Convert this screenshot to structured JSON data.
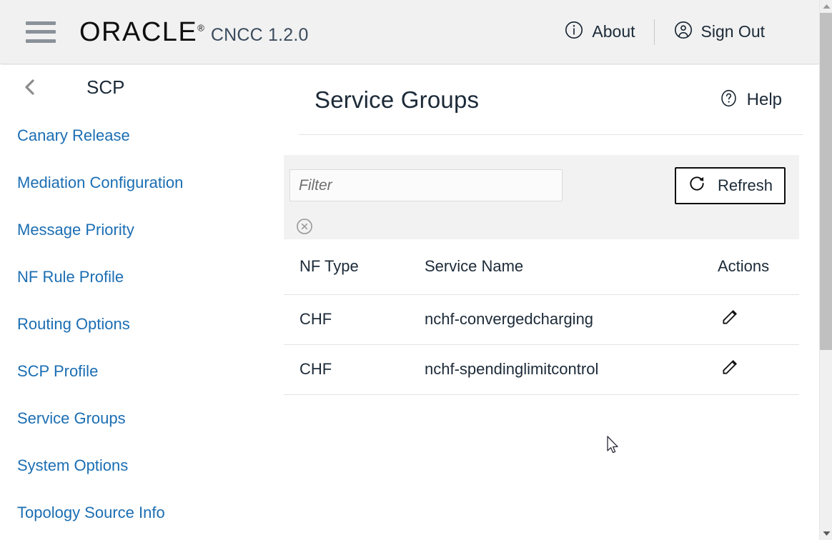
{
  "header": {
    "menu_icon": "hamburger-icon",
    "logo_text": "ORACLE",
    "logo_registered": "®",
    "app_version": "CNCC 1.2.0",
    "about_label": "About",
    "about_icon": "info-circle-icon",
    "signout_label": "Sign Out",
    "signout_icon": "user-circle-icon"
  },
  "sidebar": {
    "back_icon": "chevron-left-icon",
    "title": "SCP",
    "items": [
      {
        "label": "Canary Release"
      },
      {
        "label": "Mediation Configuration"
      },
      {
        "label": "Message Priority"
      },
      {
        "label": "NF Rule Profile"
      },
      {
        "label": "Routing Options"
      },
      {
        "label": "SCP Profile"
      },
      {
        "label": "Service Groups"
      },
      {
        "label": "System Options"
      },
      {
        "label": "Topology Source Info"
      }
    ]
  },
  "main": {
    "page_title": "Service Groups",
    "help_label": "Help",
    "help_icon": "question-circle-icon",
    "toolbar": {
      "filter_placeholder": "Filter",
      "filter_value": "",
      "clear_icon": "clear-circle-x-icon",
      "refresh_label": "Refresh",
      "refresh_icon": "refresh-circular-arrow-icon"
    },
    "table": {
      "columns": [
        "NF Type",
        "Service Name",
        "Actions"
      ],
      "rows": [
        {
          "nf_type": "CHF",
          "service_name": "nchf-convergedcharging",
          "action_icon": "edit-pencil-icon"
        },
        {
          "nf_type": "CHF",
          "service_name": "nchf-spendinglimitcontrol",
          "action_icon": "edit-pencil-icon"
        }
      ]
    }
  },
  "scrollbar": {
    "up_icon": "scroll-up-arrow-icon",
    "down_icon": "scroll-down-arrow-icon"
  },
  "colors": {
    "link_blue": "#1b6eb3",
    "header_bg": "#f1f1f1",
    "panel_bg": "#f2f2f2",
    "text_dark": "#1c2a38"
  }
}
